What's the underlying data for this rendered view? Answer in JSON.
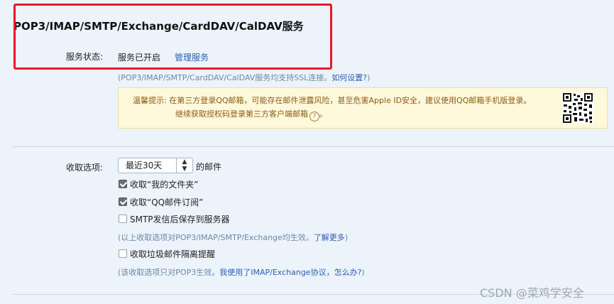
{
  "section": {
    "title": "POP3/IMAP/SMTP/Exchange/CardDAV/CalDAV服务"
  },
  "service_status": {
    "label": "服务状态:",
    "value": "服务已开启",
    "manage_link": "管理服务",
    "ssl_note": "(POP3/IMAP/SMTP/CardDAV/CalDAV服务均支持SSL连接。",
    "ssl_link": "如何设置?",
    "ssl_note_end": ")"
  },
  "tip": {
    "line1": "温馨提示:  在第三方登录QQ邮箱，可能存在邮件泄露风险，甚至危害Apple ID安全，建议使用QQ邮箱手机版登录。",
    "line2": "继续获取授权码登录第三方客户端邮箱",
    "help_glyph": "?",
    "line2_end": "。",
    "qr_icon": "qr-code-icon"
  },
  "receive": {
    "label": "收取选项:",
    "select_value": "最近30天",
    "select_suffix": "的邮件",
    "options": [
      {
        "label": "收取“我的文件夹”",
        "checked": true
      },
      {
        "label": "收取“QQ邮件订阅”",
        "checked": true
      },
      {
        "label": "SMTP发信后保存到服务器",
        "checked": false
      }
    ],
    "note1": "(以上收取选项对POP3/IMAP/SMTP/Exchange均生效。",
    "note1_link": "了解更多",
    "note1_end": ")",
    "spam_option": {
      "label": "收取垃圾邮件隔离提醒",
      "checked": false
    },
    "note2": "(该收取选项只对POP3生效。",
    "note2_link": "我使用了IMAP/Exchange协议，怎么办?",
    "note2_end": ")"
  },
  "watermark": "CSDN @菜鸡学安全",
  "colors": {
    "background": "#ecf3fb",
    "link": "#2b5fb3",
    "highlight_box": "#e6192a",
    "tip_background": "#fff9dc"
  }
}
